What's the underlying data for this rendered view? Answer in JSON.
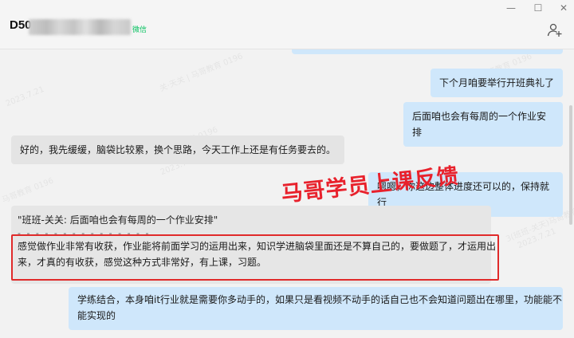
{
  "window": {
    "contact_name_visible": "D50",
    "source_tag": "微信",
    "minimize": "—",
    "maximize": "☐",
    "close": "✕"
  },
  "watermarks": [
    "马哥教育 0196",
    "关·天关 | 马哥教育 0196",
    "2023.7.21",
    "马哥教育 0196",
    "2023.7.21",
    "马哥教育 0196",
    "3(班班-关天)马哥教育 0196",
    "2023.7.21"
  ],
  "messages": {
    "m1": "下个月咱要举行开班典礼了",
    "m2": "后面咱也会有每周的一个作业安排",
    "m3": "好的，我先缓缓，脑袋比较累，换个思路，今天工作上还是有任务要去的。",
    "m4": "嗯嗯，你这边整体进度还可以的，保持就行",
    "quote_header": "\"班班-关关: 后面咱也会有每周的一个作业安排\"",
    "quote_divider": "- - - - - - - - - - - - - - -",
    "m5_line1": "感觉做作业非常有收获，作业能将前面学习的运用出来，知识学进脑袋里面还是不算自己的，要做题了，才运用出",
    "m5_line2": "来，才真的有收获，感觉这种方式非常好，有上课，习题。",
    "m6_line1": "学练结合，本身咱it行业就是需要你多动手的，如果只是看视频不动手的话自己也不会知道问题出在哪里，功能能不",
    "m6_line2": "能实现的"
  },
  "overlay": {
    "caption": "马哥学员上课反馈"
  },
  "colors": {
    "my_bubble": "#cfe7fb",
    "their_bubble": "#e4e4e4",
    "highlight_border": "#e02a2a",
    "caption": "#e8212c",
    "wechat_tag": "#07c160"
  }
}
